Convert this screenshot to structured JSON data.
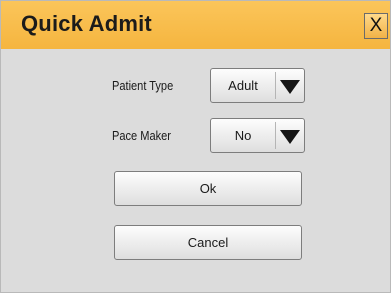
{
  "dialog": {
    "title": "Quick Admit",
    "close_label": "X"
  },
  "fields": {
    "patient_type": {
      "label": "Patient Type",
      "value": "Adult"
    },
    "pace_maker": {
      "label": "Pace Maker",
      "value": "No"
    }
  },
  "buttons": {
    "ok_label": "Ok",
    "cancel_label": "Cancel"
  },
  "colors": {
    "titlebar": "#f5b53f",
    "dialog_background": "#dcdcdc"
  }
}
